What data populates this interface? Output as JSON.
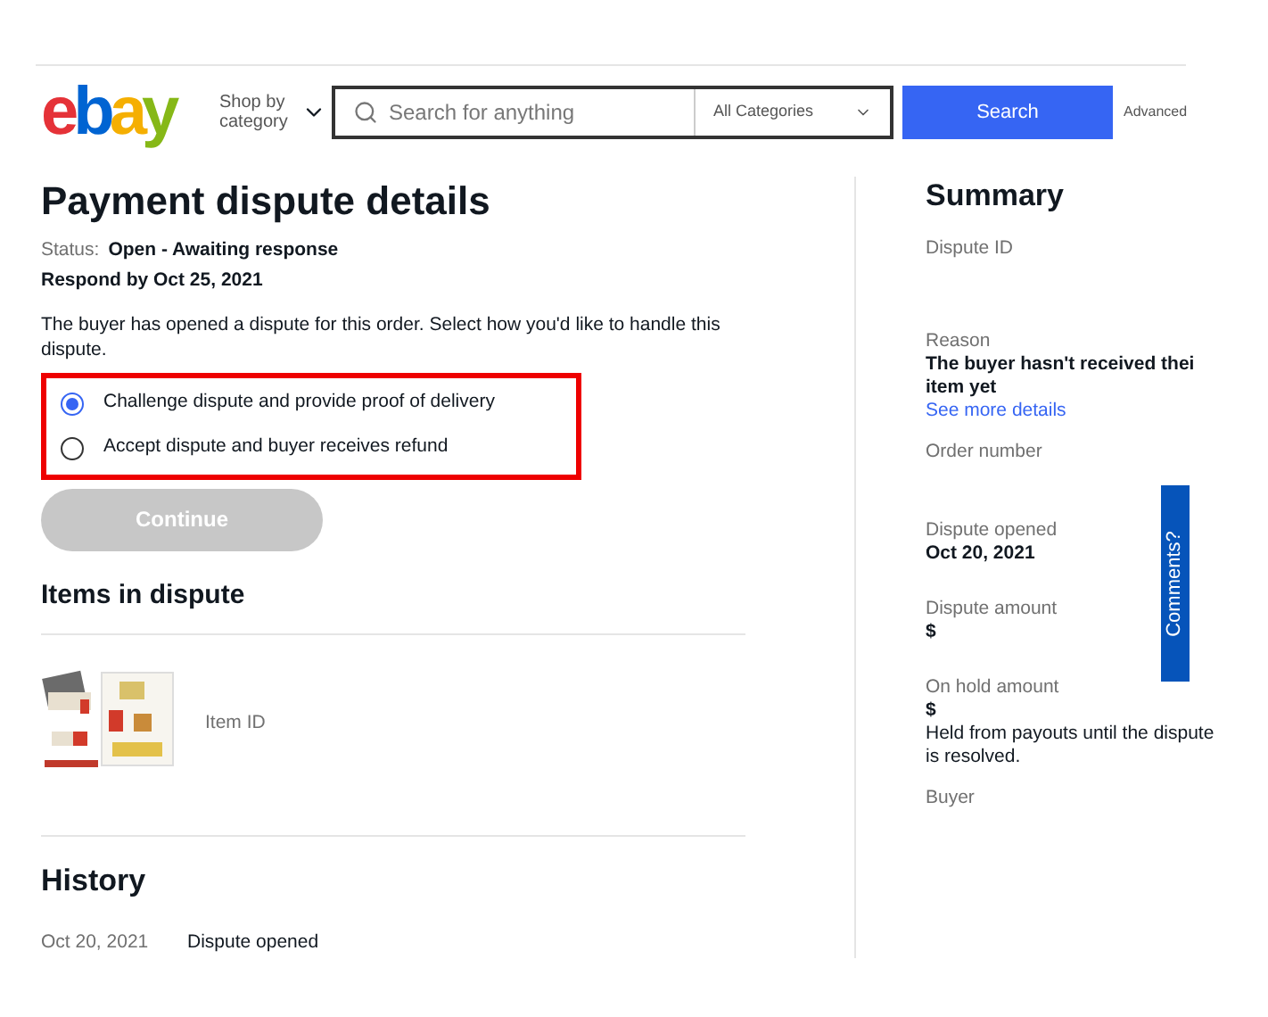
{
  "header": {
    "logo": [
      {
        "letter": "e",
        "color": "#e53238"
      },
      {
        "letter": "b",
        "color": "#0064d2"
      },
      {
        "letter": "a",
        "color": "#f5af02"
      },
      {
        "letter": "y",
        "color": "#86b817"
      }
    ],
    "shop_by": "Shop by category",
    "search": {
      "placeholder": "Search for anything"
    },
    "category": "All Categories",
    "search_button": "Search",
    "advanced": "Advanced"
  },
  "main": {
    "title": "Payment dispute details",
    "status_label": "Status:",
    "status_value": "Open - Awaiting response",
    "respond_by": "Respond by Oct 25, 2021",
    "intro": "The buyer has opened a dispute for this order. Select how you'd like to handle this dispute.",
    "options": [
      {
        "label": "Challenge dispute and provide proof of delivery",
        "selected": true
      },
      {
        "label": "Accept dispute and buyer receives refund",
        "selected": false
      }
    ],
    "continue": {
      "label": "Continue",
      "disabled": true
    },
    "items_title": "Items in dispute",
    "item": {
      "label": "Item ID"
    },
    "history_title": "History",
    "history": [
      {
        "date": "Oct 20, 2021",
        "event": "Dispute opened"
      }
    ]
  },
  "summary": {
    "title": "Summary",
    "fields": [
      {
        "label": "Dispute ID"
      },
      {
        "label": "Reason",
        "value": "The buyer hasn't received thei item yet",
        "link": "See more details"
      },
      {
        "label": "Order number"
      },
      {
        "label": "Dispute opened",
        "value": "Oct 20, 2021"
      },
      {
        "label": "Dispute amount",
        "value": "$"
      },
      {
        "label": "On hold amount",
        "value": "$",
        "note": "Held from payouts until the dispute is resolved."
      },
      {
        "label": "Buyer"
      }
    ]
  },
  "feedback_tab": "Comments?"
}
